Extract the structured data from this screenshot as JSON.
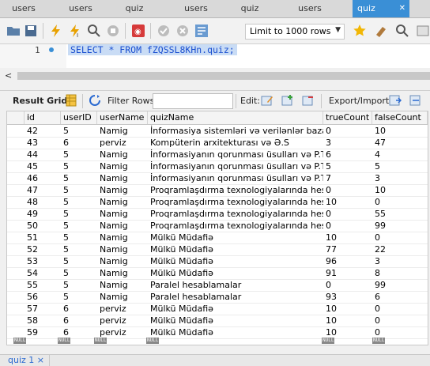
{
  "tabs": [
    {
      "label": "users"
    },
    {
      "label": "users"
    },
    {
      "label": "quiz"
    },
    {
      "label": "users"
    },
    {
      "label": "quiz"
    },
    {
      "label": "users"
    },
    {
      "label": "quiz",
      "active": true
    }
  ],
  "tab_close": "✕",
  "toolbar": {
    "limit_label": "Limit to 1000 rows",
    "icons": [
      "folder-open-icon",
      "save-icon",
      "execute-icon",
      "execute-selection-icon",
      "explain-icon",
      "stop-icon",
      "toggle-autocommit-icon",
      "commit-icon",
      "rollback-icon",
      "beautify-icon",
      "limit-dropdown-icon",
      "bookmark-icon",
      "format-icon",
      "find-icon"
    ]
  },
  "editor": {
    "line_number": "1",
    "sql": "SELECT * FROM fZQSSL8KHn.quiz;"
  },
  "result_bar": {
    "result_grid": "Result Grid",
    "filter_rows": "Filter Rows:",
    "edit": "Edit:",
    "export_import": "Export/Import:"
  },
  "columns": [
    "id",
    "userID",
    "userName",
    "quizName",
    "trueCount",
    "falseCount"
  ],
  "rows": [
    [
      "42",
      "5",
      "Namig",
      "İnformasiya sistemləri və verilənlər bazası",
      "0",
      "10"
    ],
    [
      "43",
      "6",
      "perviz",
      "Kompüterin arxitekturası və Ə.S",
      "3",
      "47"
    ],
    [
      "44",
      "5",
      "Namig",
      "İnformasiyanın qorunması üsulları və P.T",
      "6",
      "4"
    ],
    [
      "45",
      "5",
      "Namig",
      "İnformasiyanın qorunması üsulları və P.T",
      "5",
      "5"
    ],
    [
      "46",
      "5",
      "Namig",
      "İnformasiyanın qorunması üsulları və P.T",
      "7",
      "3"
    ],
    [
      "47",
      "5",
      "Namig",
      "Proqramlaşdırma texnologiyalarında hesa...",
      "0",
      "10"
    ],
    [
      "48",
      "5",
      "Namig",
      "Proqramlaşdırma texnologiyalarında hesa...",
      "10",
      "0"
    ],
    [
      "49",
      "5",
      "Namig",
      "Proqramlaşdırma texnologiyalarında hesa...",
      "0",
      "55"
    ],
    [
      "50",
      "5",
      "Namig",
      "Proqramlaşdırma texnologiyalarında hesa...",
      "0",
      "99"
    ],
    [
      "51",
      "5",
      "Namig",
      "Mülkü Müdafiə",
      "10",
      "0"
    ],
    [
      "52",
      "5",
      "Namig",
      "Mülkü Müdafiə",
      "77",
      "22"
    ],
    [
      "53",
      "5",
      "Namig",
      "Mülkü Müdafiə",
      "96",
      "3"
    ],
    [
      "54",
      "5",
      "Namig",
      "Mülkü Müdafiə",
      "91",
      "8"
    ],
    [
      "55",
      "5",
      "Namig",
      "Paralel hesablamalar",
      "0",
      "99"
    ],
    [
      "56",
      "5",
      "Namig",
      "Paralel hesablamalar",
      "93",
      "6"
    ],
    [
      "57",
      "6",
      "perviz",
      "Mülkü Müdafiə",
      "10",
      "0"
    ],
    [
      "58",
      "6",
      "perviz",
      "Mülkü Müdafiə",
      "10",
      "0"
    ],
    [
      "59",
      "6",
      "perviz",
      "Mülkü Müdafiə",
      "10",
      "0"
    ]
  ],
  "null_label": "NULL",
  "bottom_tab": "quiz 1 ×"
}
